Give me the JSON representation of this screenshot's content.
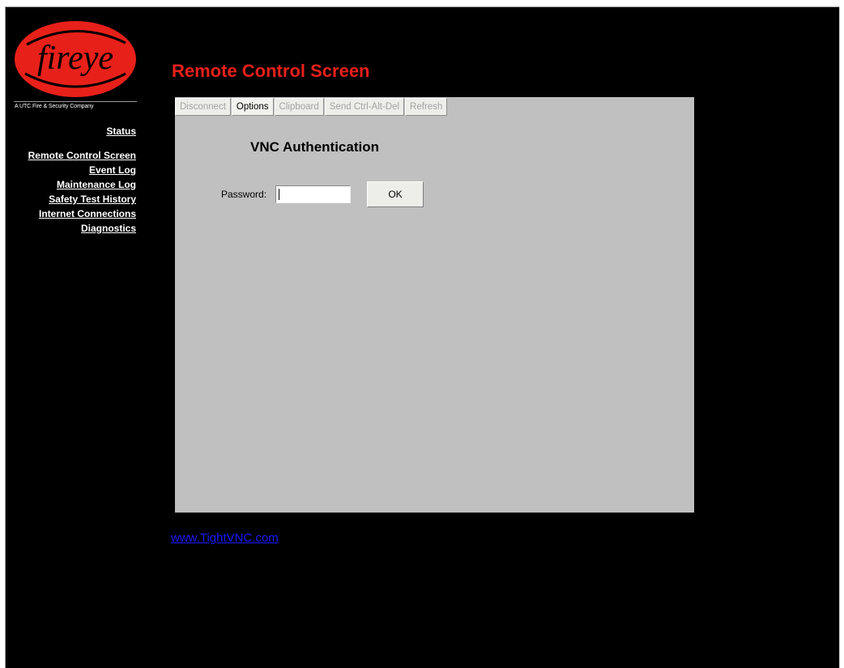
{
  "brand": {
    "logo_text": "fireye",
    "tagline": "A UTC Fire & Security Company",
    "logo_color": "#e8201a"
  },
  "nav": {
    "status": "Status",
    "items": [
      "Remote Control Screen",
      "Event Log",
      "Maintenance Log",
      "Safety Test History",
      "Internet Connections",
      "Diagnostics"
    ]
  },
  "page_title": "Remote Control Screen",
  "toolbar": {
    "buttons": [
      {
        "label": "Disconnect",
        "enabled": false
      },
      {
        "label": "Options",
        "enabled": true
      },
      {
        "label": "Clipboard",
        "enabled": false
      },
      {
        "label": "Send Ctrl-Alt-Del",
        "enabled": false
      },
      {
        "label": "Refresh",
        "enabled": false
      }
    ]
  },
  "auth": {
    "title": "VNC Authentication",
    "password_label": "Password:",
    "password_value": "",
    "ok_label": "OK"
  },
  "footer": {
    "link_text": "www.TightVNC.com"
  },
  "colors": {
    "background": "#000000",
    "title": "#e8201a",
    "applet": "#c0c0c0",
    "link": "#1a1aff"
  }
}
